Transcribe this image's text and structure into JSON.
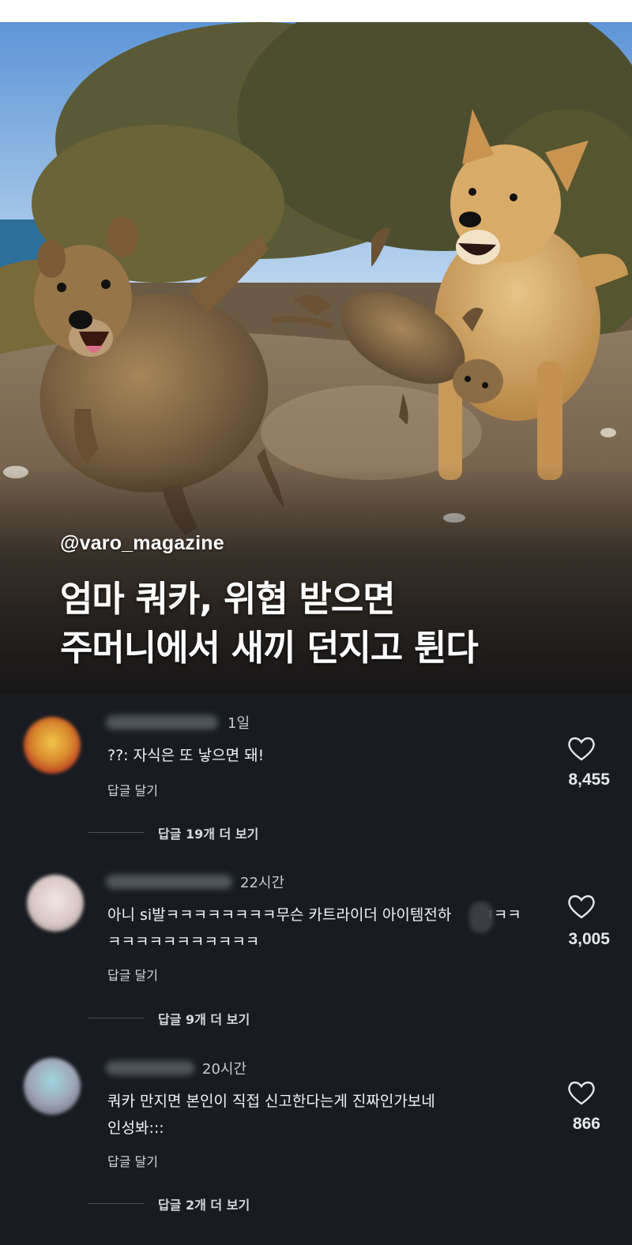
{
  "post": {
    "handle": "@varo_magazine",
    "headline_line1": "엄마 쿼카, 위협 받으면",
    "headline_line2": "주머니에서 새끼 던지고 튄다"
  },
  "comments": [
    {
      "time": "1일",
      "text_lines": [
        "??: 자식은 또 낳으면 돼!"
      ],
      "reply_label": "답글 달기",
      "like_count": "8,455",
      "more_replies": "답글 19개 더 보기",
      "avatar_color": "#d98a2e"
    },
    {
      "time": "22시간",
      "text_lines": [
        "아니 si발ㅋㅋㅋㅋㅋㅋㅋㅋ무슨 카트라이더 아이템전하",
        "ㅋㅋㅋㅋㅋㅋㅋㅋㅋㅋㅋ"
      ],
      "text_tail": "ㅋㅋㅋ",
      "reply_label": "답글 달기",
      "like_count": "3,005",
      "more_replies": "답글 9개 더 보기",
      "avatar_color": "#d8c8c6"
    },
    {
      "time": "20시간",
      "text_lines": [
        "쿼카 만지면 본인이 직접 신고한다는게 진짜인가보네",
        "인성봐:::"
      ],
      "reply_label": "답글 달기",
      "like_count": "866",
      "more_replies": "답글 2개 더 보기",
      "avatar_color": "#9fa7b6"
    }
  ],
  "icons": {
    "like": "heart-icon"
  },
  "colors": {
    "background": "#181c22",
    "text": "#f1f2f4",
    "muted": "#c8cbd0"
  }
}
